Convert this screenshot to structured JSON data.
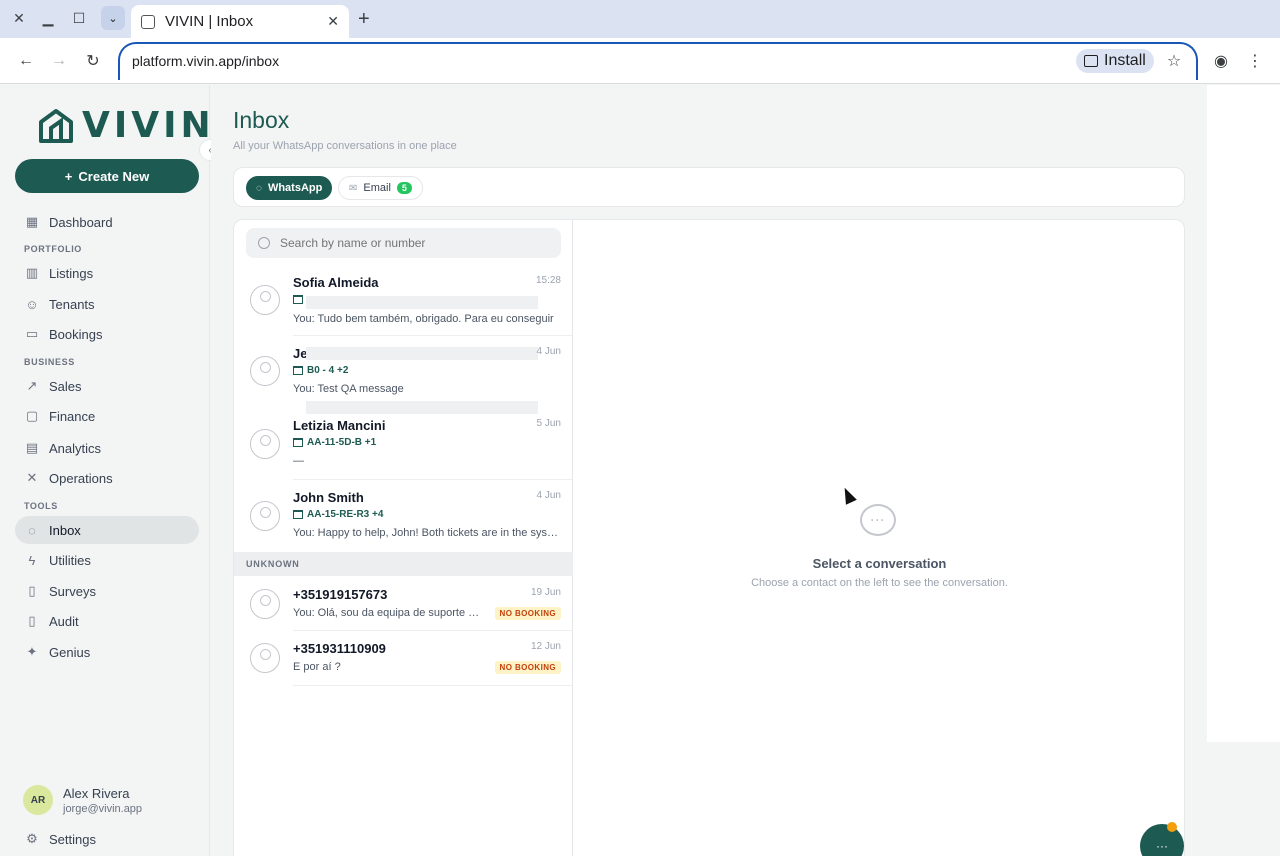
{
  "browser": {
    "tab_title": "VIVIN | Inbox",
    "url": "platform.vivin.app/inbox",
    "install_label": "Install"
  },
  "brand": {
    "logo_text": "VIVIN",
    "accent": "#1d5a52"
  },
  "sidebar": {
    "create_label": "Create New",
    "dashboard": "Dashboard",
    "sections": {
      "portfolio": "PORTFOLIO",
      "business": "BUSINESS",
      "tools": "TOOLS"
    },
    "items": {
      "listings": "Listings",
      "tenants": "Tenants",
      "bookings": "Bookings",
      "sales": "Sales",
      "finance": "Finance",
      "analytics": "Analytics",
      "operations": "Operations",
      "inbox": "Inbox",
      "utilities": "Utilities",
      "surveys": "Surveys",
      "audit": "Audit",
      "genius": "Genius"
    },
    "user": {
      "initials": "AR",
      "name": "Alex Rivera",
      "email": "jorge@vivin.app"
    },
    "settings": "Settings"
  },
  "main": {
    "title": "Inbox",
    "subtitle": "All your WhatsApp conversations in one place",
    "channels": {
      "whatsapp": "WhatsApp",
      "email": "Email",
      "email_count": "5"
    },
    "search_placeholder": "Search by name or number",
    "conversations": [
      {
        "name": "Sofia Almeida",
        "date": "15:28",
        "tag": "",
        "message": "You: Tudo bem também, obrigado. Para eu conseguir"
      },
      {
        "name": "Je",
        "date": "4 Jun",
        "tag": "B0 - 4 +2",
        "message": "You: Test QA message"
      },
      {
        "name": "Letizia Mancini",
        "date": "5 Jun",
        "tag": "AA-11-5D-B +1",
        "message": "—"
      },
      {
        "name": "John Smith",
        "date": "4 Jun",
        "tag": "AA-15-RE-R3 +4",
        "message": "You: Happy to help, John! Both tickets are in the system"
      }
    ],
    "unknown_label": "UNKNOWN",
    "unknown": [
      {
        "name": "+351919157673",
        "date": "19 Jun",
        "message": "You: Olá, sou da equipa de suporte da Vivin",
        "badge": "NO BOOKING"
      },
      {
        "name": "+351931110909",
        "date": "12 Jun",
        "message": "E por aí ?",
        "badge": "NO BOOKING"
      }
    ],
    "empty": {
      "title": "Select a conversation",
      "subtitle": "Choose a contact on the left to see the conversation."
    }
  }
}
